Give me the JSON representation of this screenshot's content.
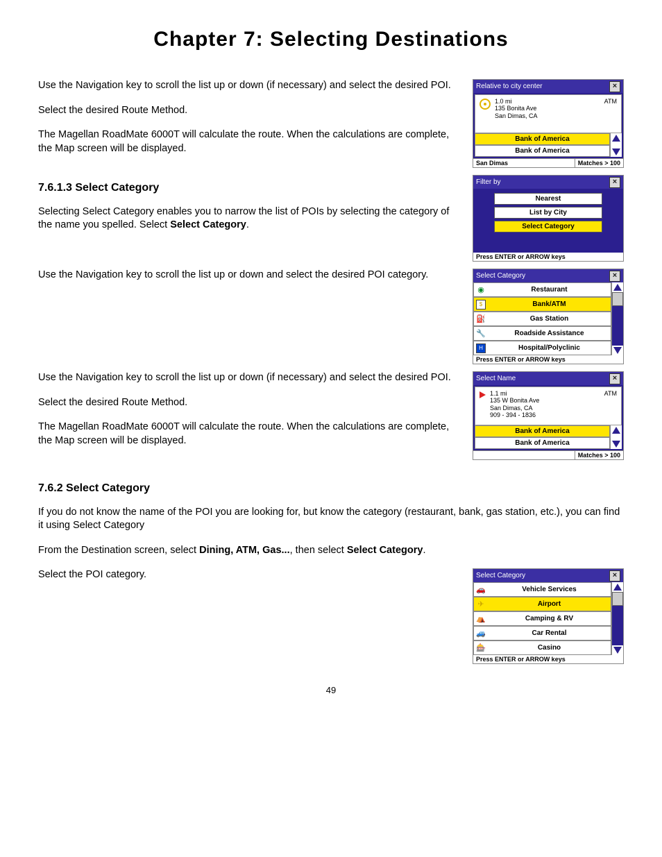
{
  "chapter_title": "Chapter 7: Selecting Destinations",
  "page_number": "49",
  "text": {
    "p1": "Use the Navigation key to scroll the list up or down (if necessary) and select the desired POI.",
    "p2": "Select the desired Route Method.",
    "p3": "The Magellan RoadMate 6000T will calculate the route. When the calculations are complete, the Map screen will be displayed.",
    "h7613": "7.6.1.3 Select Category",
    "p4a": "Selecting Select Category enables you to narrow the list of POIs by selecting the category of the name you spelled.  Select ",
    "p4b": "Select Category",
    "p4c": ".",
    "p5": "Use the Navigation key to scroll the list up or down and select the desired POI category.",
    "p6": "Use the Navigation key to scroll the list up or down (if necessary) and select the desired POI.",
    "p7": "Select the desired Route Method.",
    "p8": "The Magellan RoadMate 6000T will calculate the route. When the calculations are complete, the Map screen will be displayed.",
    "h762": "7.6.2 Select Category",
    "p9": "If you do not know the name of the POI you are looking for, but know the category (restaurant, bank, gas station, etc.), you can find it using Select Category",
    "p10a": "From the Destination screen, select ",
    "p10b": "Dining, ATM, Gas...",
    "p10c": ", then select ",
    "p10d": "Select Category",
    "p10e": ".",
    "p11": "Select the POI category."
  },
  "screens": {
    "s1": {
      "title": "Relative to city center",
      "distance": "1.0 mi",
      "addr1": "135 Bonita Ave",
      "addr2": "San Dimas, CA",
      "type": "ATM",
      "row1": "Bank of America",
      "row2": "Bank of America",
      "footL": "San Dimas",
      "footR": "Matches > 100"
    },
    "s2": {
      "title": "Filter by",
      "opt1": "Nearest",
      "opt2": "List by City",
      "opt3": "Select Category",
      "hint": "Press ENTER or ARROW keys"
    },
    "s3": {
      "title": "Select Category",
      "r1": "Restaurant",
      "r2": "Bank/ATM",
      "r3": "Gas Station",
      "r4": "Roadside Assistance",
      "r5": "Hospital/Polyclinic",
      "hint": "Press ENTER or ARROW keys"
    },
    "s4": {
      "title": "Select Name",
      "distance": "1.1 mi",
      "addr1": "135 W Bonita Ave",
      "addr2": "San Dimas, CA",
      "addr3": "909 - 394 - 1836",
      "type": "ATM",
      "row1": "Bank of America",
      "row2": "Bank of America",
      "footR": "Matches > 100"
    },
    "s5": {
      "title": "Select Category",
      "r1": "Vehicle Services",
      "r2": "Airport",
      "r3": "Camping & RV",
      "r4": "Car Rental",
      "r5": "Casino",
      "hint": "Press ENTER or ARROW keys"
    }
  }
}
